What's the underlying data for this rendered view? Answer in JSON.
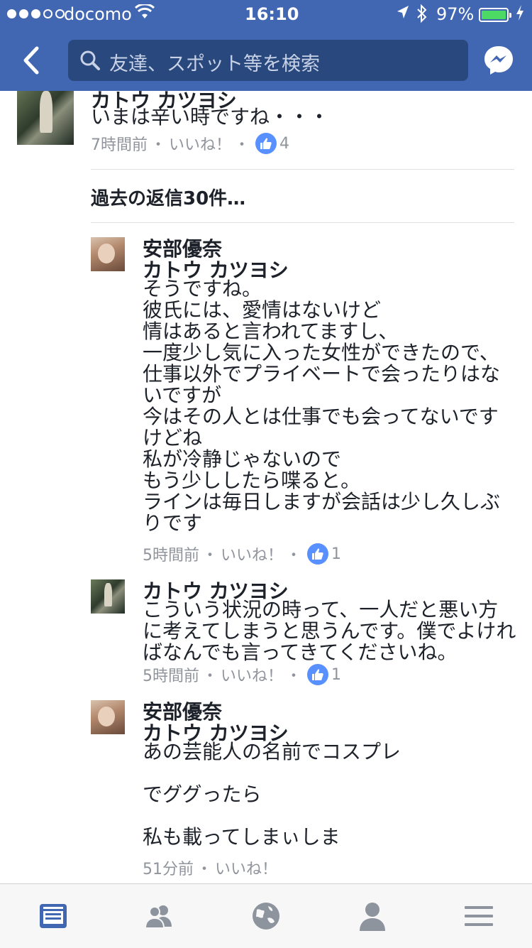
{
  "status_bar": {
    "carrier": "docomo",
    "time": "16:10",
    "battery_percent": "97%",
    "battery_level": 0.97,
    "signal_bars_filled": 3,
    "signal_bars_total": 5
  },
  "nav": {
    "search_placeholder": "友達、スポット等を検索"
  },
  "comments": [
    {
      "author": "カトウ カツヨシ",
      "body": "いまは辛い時ですね・・・",
      "time": "7時間前",
      "like_label": "いいね！",
      "like_count": "4",
      "avatar": "man"
    }
  ],
  "previous_replies_label": "過去の返信30件…",
  "replies": [
    {
      "author": "安部優奈",
      "mention": "カトウ カツヨシ",
      "body": "そうですね。\n彼氏には、愛情はないけど\n情はあると言われてますし、\n一度少し気に入った女性ができたので、\n仕事以外でプライベートで会ったりはな\nいですが\n今はその人とは仕事でも会ってないです\nけどね\n私が冷静じゃないので\nもう少ししたら喋ると。\nラインは毎日しますが会話は少し久しぶ\nりです",
      "time": "5時間前",
      "like_label": "いいね！",
      "like_count": "1",
      "avatar": "woman"
    },
    {
      "author": "カトウ カツヨシ",
      "body": "こういう状況の時って、一人だと悪い方\nに考えてしまうと思うんです。僕でよけれ\nばなんでも言ってきてくださいね。",
      "time": "5時間前",
      "like_label": "いいね！",
      "like_count": "1",
      "avatar": "man"
    },
    {
      "author": "安部優奈",
      "mention": "カトウ カツヨシ",
      "body": "あの芸能人の名前でコスプレ\n\nでググったら\n\n私も載ってしまぃしま",
      "time": "51分前",
      "like_label": "いいね！",
      "avatar": "woman"
    }
  ],
  "tabs": [
    "news-feed",
    "friends",
    "notifications-globe",
    "profile",
    "menu"
  ],
  "colors": {
    "brand": "#4267b2",
    "like": "#5890ff",
    "active_tab": "#4267b2",
    "inactive_tab": "#8d949e"
  }
}
